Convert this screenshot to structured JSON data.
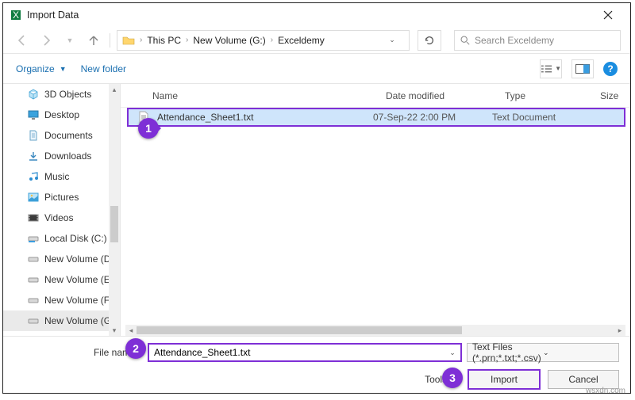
{
  "window": {
    "title": "Import Data"
  },
  "nav": {
    "pc": "This PC",
    "drive": "New Volume (G:)",
    "folder": "Exceldemy",
    "search_placeholder": "Search Exceldemy"
  },
  "toolbar": {
    "organize": "Organize",
    "newfolder": "New folder"
  },
  "columns": {
    "name": "Name",
    "date": "Date modified",
    "type": "Type",
    "size": "Size"
  },
  "sidebar": {
    "items": [
      "3D Objects",
      "Desktop",
      "Documents",
      "Downloads",
      "Music",
      "Pictures",
      "Videos",
      "Local Disk (C:)",
      "New Volume (D:)",
      "New Volume (E:)",
      "New Volume (F:)",
      "New Volume (G:)"
    ]
  },
  "file": {
    "name": "Attendance_Sheet1.txt",
    "date": "07-Sep-22 2:00 PM",
    "type": "Text Document"
  },
  "bottom": {
    "label": "File name:",
    "value": "Attendance_Sheet1.txt",
    "filter": "Text Files (*.prn;*.txt;*.csv)",
    "tools": "Tools",
    "import": "Import",
    "cancel": "Cancel"
  },
  "pins": {
    "p1": "1",
    "p2": "2",
    "p3": "3"
  },
  "watermark": "wsxdn.com"
}
